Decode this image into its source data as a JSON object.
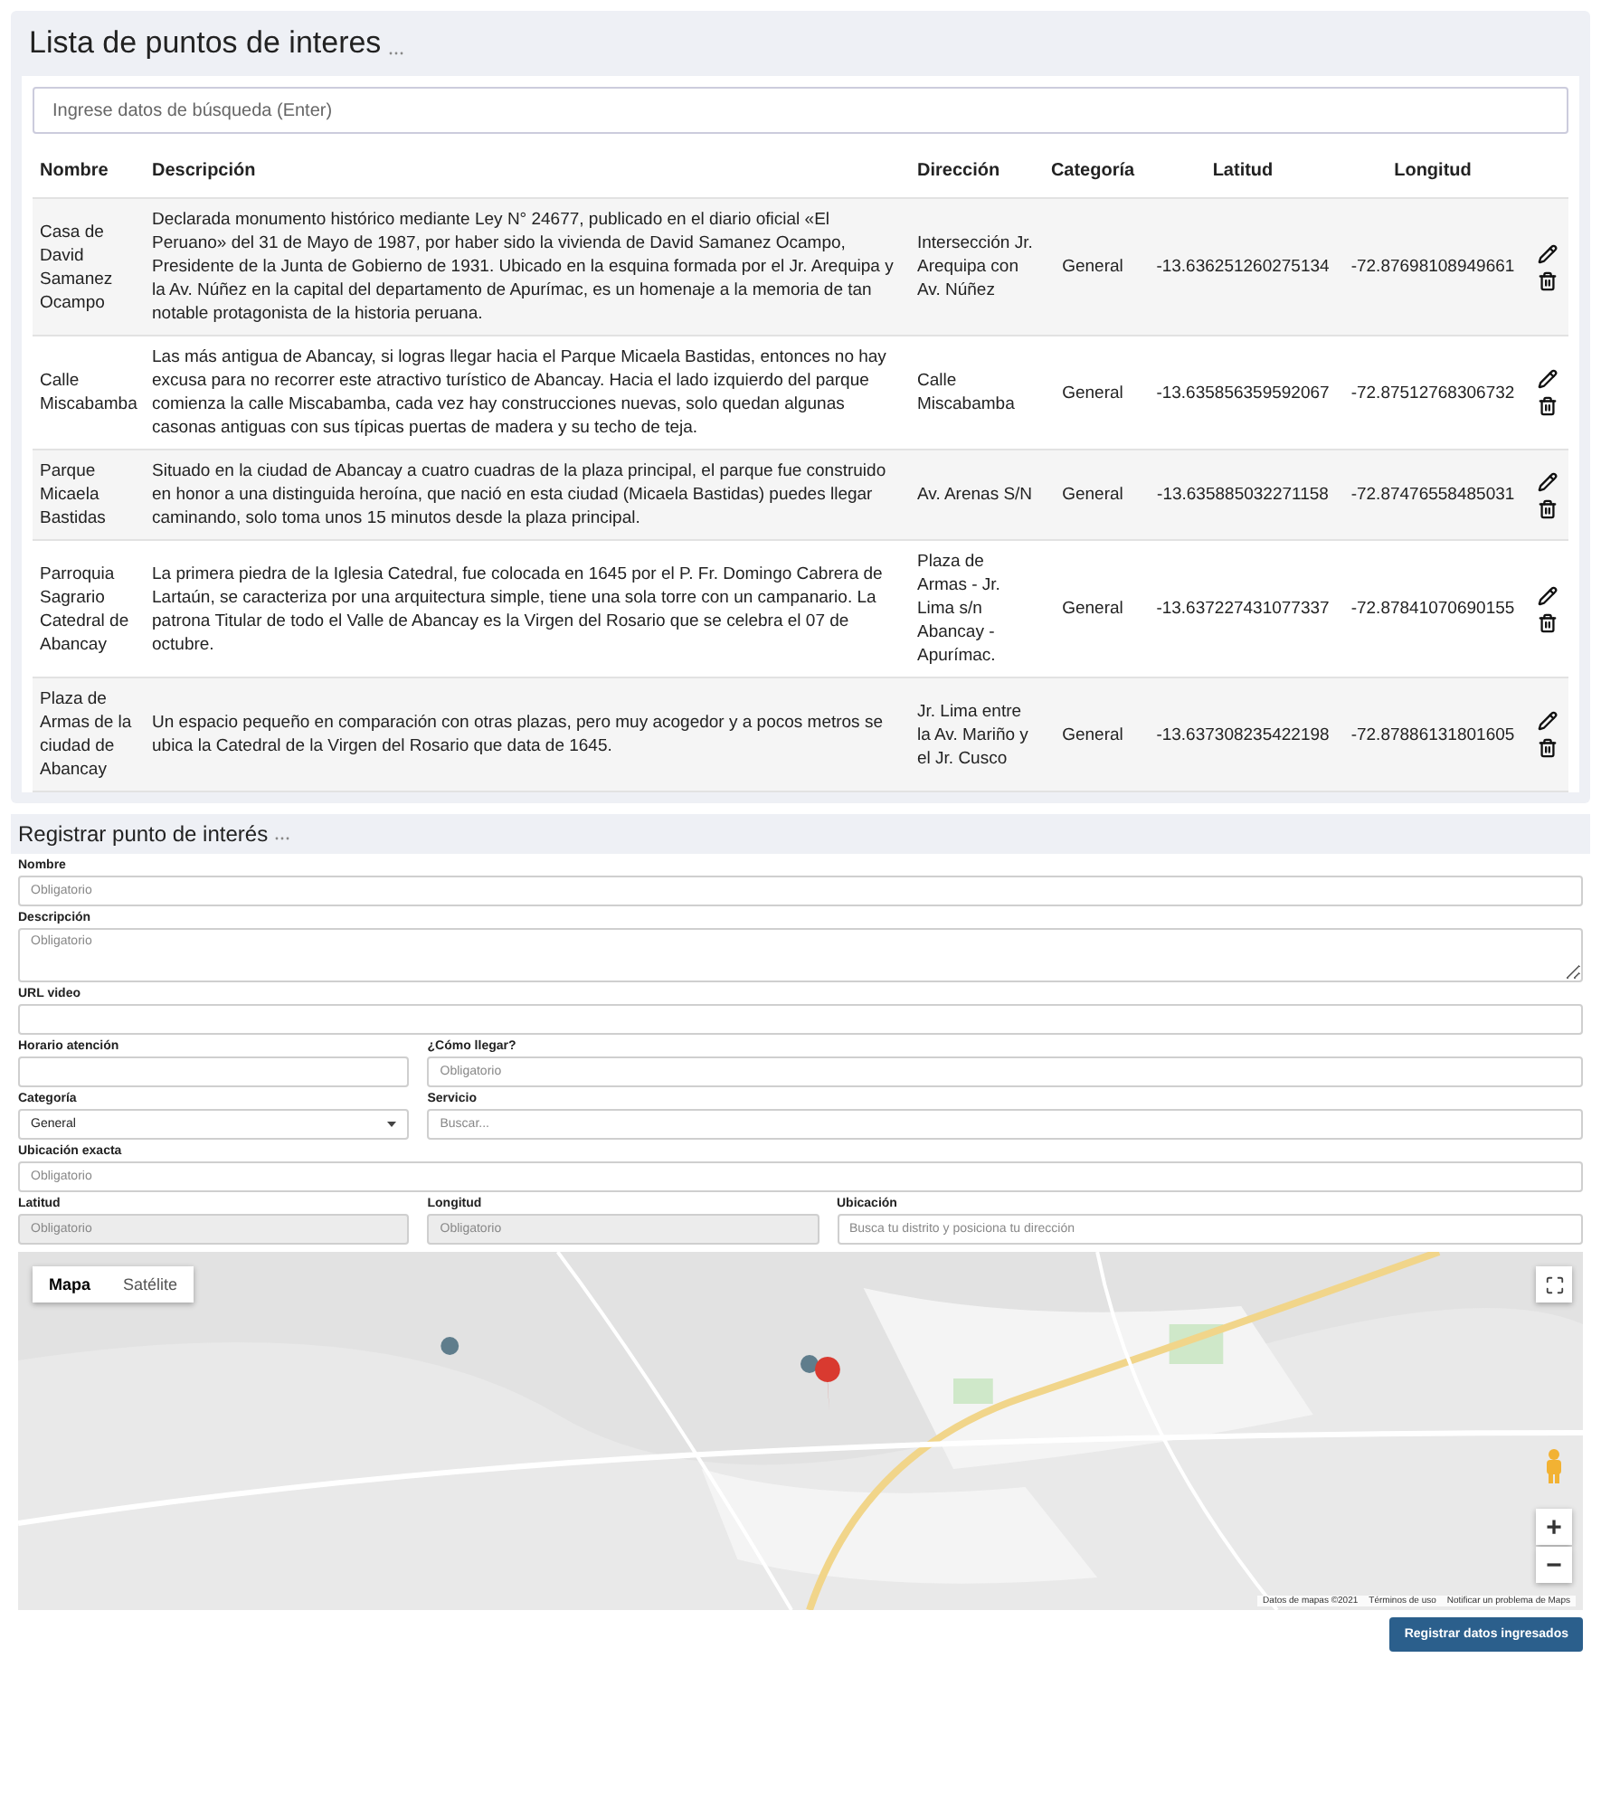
{
  "list_section": {
    "title": "Lista de puntos de interes",
    "search": {
      "placeholder": "Ingrese datos de búsqueda (Enter)"
    },
    "table": {
      "columns": [
        "Nombre",
        "Descripción",
        "Dirección",
        "Categoría",
        "Latitud",
        "Longitud"
      ],
      "rows": [
        {
          "nombre": "Casa de David Samanez Ocampo",
          "descripcion": "Declarada monumento histórico mediante Ley N° 24677, publicado en el diario oficial «El Peruano» del 31 de Mayo de 1987, por haber sido la vivienda de David Samanez Ocampo, Presidente de la Junta de Gobierno de 1931. Ubicado en la esquina formada por el Jr. Arequipa y la Av. Núñez en la capital del departamento de Apurímac, es un homenaje a la memoria de tan notable protagonista de la historia peruana.",
          "direccion": "Intersección Jr. Arequipa con Av. Núñez",
          "categoria": "General",
          "latitud": "-13.636251260275134",
          "longitud": "-72.87698108949661"
        },
        {
          "nombre": "Calle Miscabamba",
          "descripcion": "Las más antigua de Abancay, si logras llegar hacia el Parque Micaela Bastidas, entonces no hay excusa para no recorrer este atractivo turístico de Abancay. Hacia el lado izquierdo del parque comienza la calle Miscabamba, cada vez hay construcciones nuevas, solo quedan algunas casonas antiguas con sus típicas puertas de madera y su techo de teja.",
          "direccion": "Calle Miscabamba",
          "categoria": "General",
          "latitud": "-13.635856359592067",
          "longitud": "-72.87512768306732"
        },
        {
          "nombre": "Parque Micaela Bastidas",
          "descripcion": "Situado en la ciudad de Abancay a cuatro cuadras de la plaza principal, el parque fue construido en honor a una distinguida heroína, que nació en esta ciudad (Micaela Bastidas) puedes llegar caminando, solo toma unos 15 minutos desde la plaza principal.",
          "direccion": "Av. Arenas S/N",
          "categoria": "General",
          "latitud": "-13.635885032271158",
          "longitud": "-72.87476558485031"
        },
        {
          "nombre": "Parroquia Sagrario Catedral de Abancay",
          "descripcion": "La primera piedra de la Iglesia Catedral, fue colocada en 1645 por el P. Fr. Domingo Cabrera de Lartaún, se caracteriza por una arquitectura simple, tiene una sola torre con un campanario. La patrona Titular de todo el Valle de Abancay es la Virgen del Rosario que se celebra el 07 de octubre.",
          "direccion": "Plaza de Armas - Jr. Lima s/n Abancay - Apurímac.",
          "categoria": "General",
          "latitud": "-13.637227431077337",
          "longitud": "-72.87841070690155"
        },
        {
          "nombre": "Plaza de Armas de la ciudad de Abancay",
          "descripcion": "Un espacio pequeño en comparación con otras plazas, pero muy acogedor y a pocos metros se ubica la Catedral de la Virgen del Rosario que data de 1645.",
          "direccion": "Jr. Lima entre la Av. Mariño y el Jr. Cusco",
          "categoria": "General",
          "latitud": "-13.637308235422198",
          "longitud": "-72.87886131801605"
        }
      ]
    }
  },
  "form_section": {
    "title": "Registrar punto de interés",
    "rows": [
      [
        {
          "label": "Nombre",
          "kind": "text",
          "placeholder": "Obligatorio"
        }
      ],
      [
        {
          "label": "Descripción",
          "kind": "textarea",
          "placeholder": "Obligatorio"
        }
      ],
      [
        {
          "label": "URL video",
          "kind": "text"
        }
      ],
      [
        {
          "label": "Horario atención",
          "kind": "text"
        },
        {
          "label": "¿Cómo llegar?",
          "kind": "text",
          "placeholder": "Obligatorio"
        }
      ],
      [
        {
          "label": "Categoría",
          "kind": "select",
          "value": "General"
        },
        {
          "label": "Servicio",
          "kind": "text",
          "placeholder": "Buscar..."
        }
      ],
      [
        {
          "label": "Ubicación exacta",
          "kind": "text",
          "placeholder": "Obligatorio"
        }
      ],
      [
        {
          "label": "Latitud",
          "kind": "readonly",
          "placeholder": "Obligatorio"
        },
        {
          "label": "Longitud",
          "kind": "readonly",
          "placeholder": "Obligatorio"
        },
        {
          "label": "Ubicación",
          "kind": "text",
          "placeholder": "Busca tu distrito y posiciona tu dirección"
        }
      ]
    ],
    "map": {
      "map_types": [
        {
          "label": "Mapa",
          "selected": true
        },
        {
          "label": "Satélite",
          "selected": false
        }
      ],
      "zoom_in": "+",
      "zoom_out": "−",
      "attribution": [
        "Datos de mapas ©2021",
        "Términos de uso",
        "Notificar un problema de Maps"
      ]
    },
    "submit_button": "Registrar datos ingresados"
  }
}
